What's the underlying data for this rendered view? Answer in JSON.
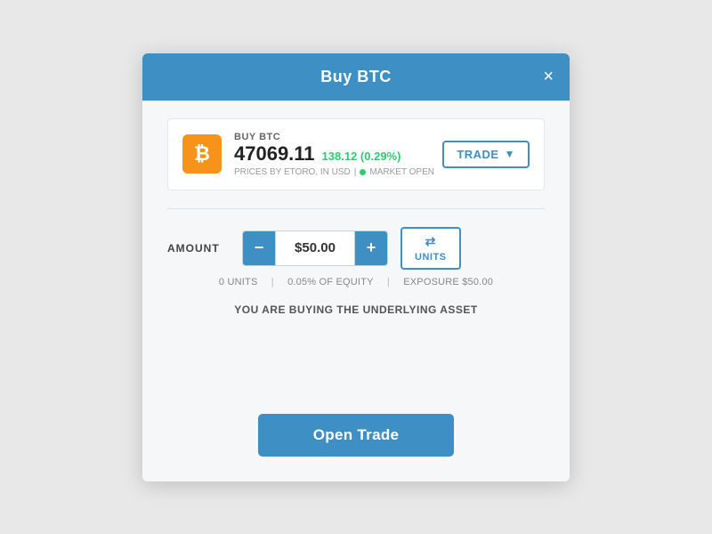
{
  "modal": {
    "title": "Buy BTC",
    "close_label": "×"
  },
  "asset": {
    "icon_text": "₿",
    "buy_label": "BUY BTC",
    "price": "47069.11",
    "change": "138.12 (0.29%)",
    "meta_provider": "PRICES BY ETORO, IN USD",
    "market_status": "MARKET OPEN"
  },
  "trade_dropdown": {
    "label": "TRADE",
    "chevron": "▼"
  },
  "amount": {
    "label": "AMOUNT",
    "value": "$50.00",
    "minus": "−",
    "plus": "+"
  },
  "units_btn": {
    "icon": "⇄",
    "label": "UNITS"
  },
  "amount_meta": {
    "units": "0 UNITS",
    "equity": "0.05% OF EQUITY",
    "exposure": "EXPOSURE $50.00"
  },
  "underlying_msg": "YOU ARE BUYING THE UNDERLYING ASSET",
  "open_trade_btn": "Open Trade"
}
